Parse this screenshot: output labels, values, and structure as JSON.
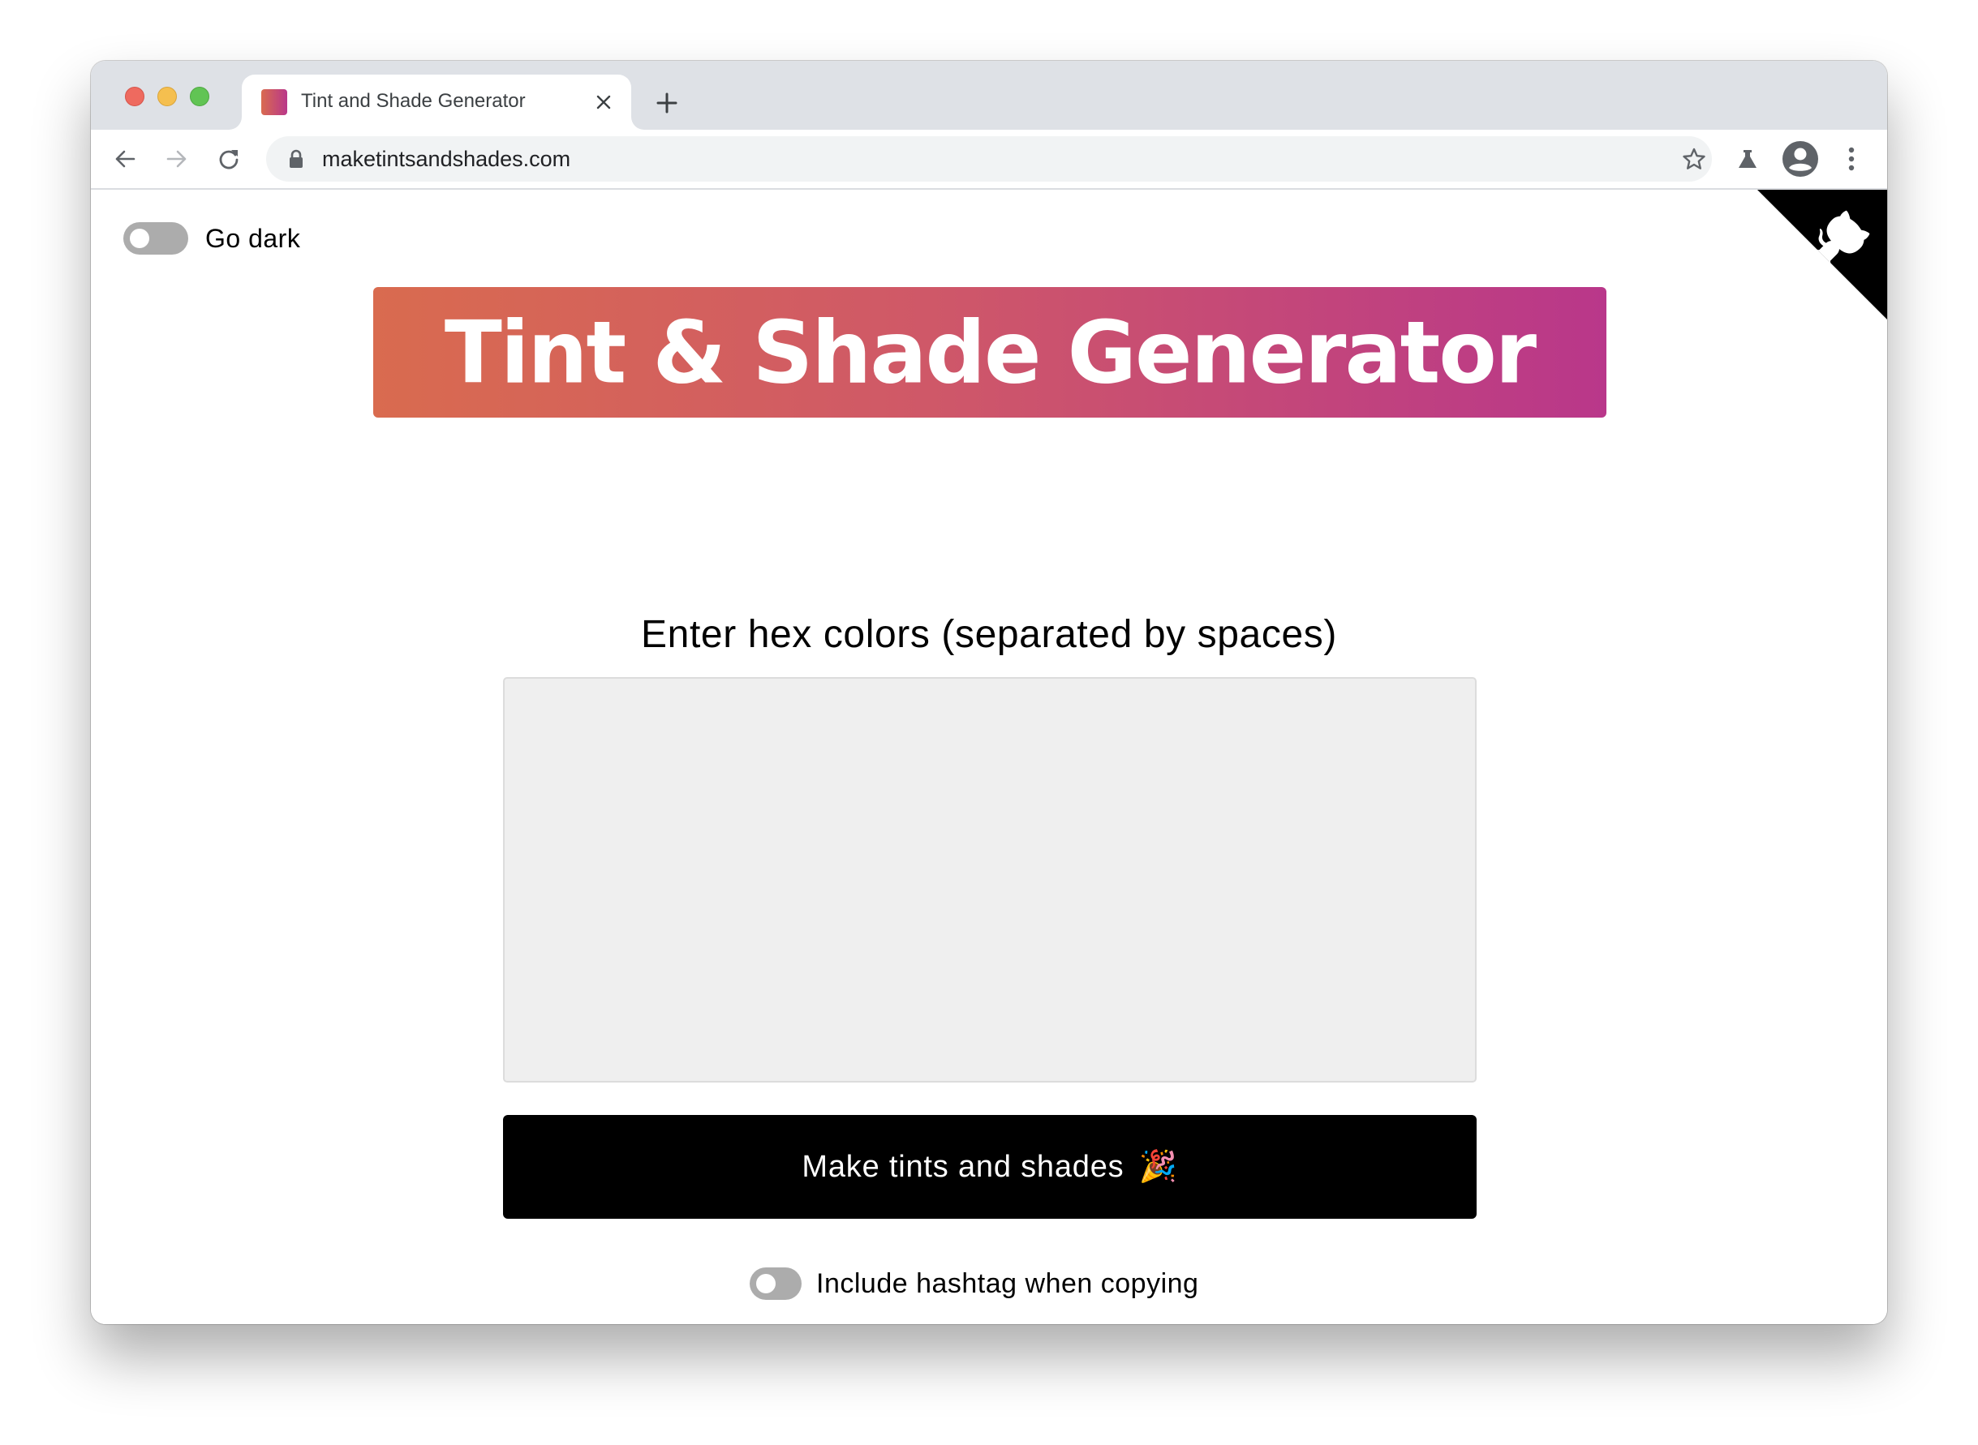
{
  "browser": {
    "tab": {
      "title": "Tint and Shade Generator",
      "favicon": "gradient-square-icon",
      "close_icon": "close-icon"
    },
    "new_tab_icon": "plus-icon",
    "toolbar": {
      "back_icon": "arrow-left-icon",
      "forward_icon": "arrow-right-icon",
      "reload_icon": "reload-icon",
      "url": "maketintsandshades.com",
      "lock_icon": "lock-icon",
      "bookmark_icon": "star-icon",
      "labs_icon": "flask-icon",
      "profile_icon": "account-circle-icon",
      "menu_icon": "more-vertical-icon"
    }
  },
  "page": {
    "dark_mode_toggle": {
      "label": "Go dark",
      "on": false
    },
    "github_corner": {
      "icon": "github-octocat-icon"
    },
    "banner": {
      "title": "Tint & Shade Generator",
      "gradient_start": "#d96b4f",
      "gradient_end": "#b9378a"
    },
    "input_label": "Enter hex colors (separated by spaces)",
    "hex_input": {
      "value": "",
      "placeholder": ""
    },
    "make_button": {
      "label": "Make tints and shades",
      "emoji": "🎉"
    },
    "hashtag_toggle": {
      "label": "Include hashtag when copying",
      "on": false
    }
  }
}
